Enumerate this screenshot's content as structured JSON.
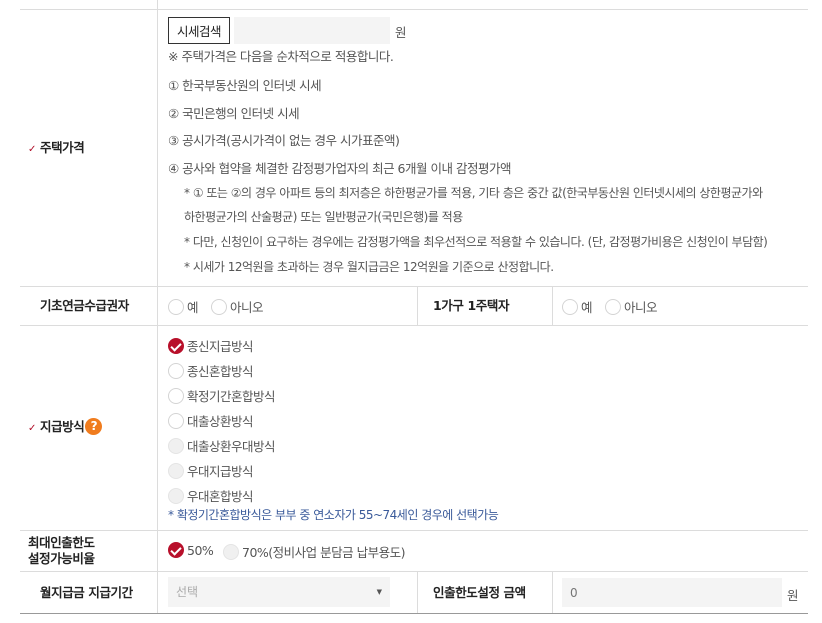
{
  "house_price": {
    "label": "주택가격",
    "search_button": "시세검색",
    "input_value": "",
    "unit": "원",
    "note": "※ 주택가격은 다음을 순차적으로 적용합니다.",
    "items": [
      "① 한국부동산원의 인터넷 시세",
      "② 국민은행의 인터넷 시세",
      "③ 공시가격(공시가격이 없는 경우 시가표준액)",
      "④ 공사와 협약을 체결한 감정평가업자의 최근 6개월 이내 감정평가액"
    ],
    "notes": [
      "* ① 또는 ②의 경우 아파트 등의 최저층은 하한평균가를 적용, 기타 층은 중간 값(한국부동산원 인터넷시세의 상한평균가와",
      "하한평균가의 산술평균) 또는 일반평균가(국민은행)를 적용",
      "* 다만, 신청인이 요구하는 경우에는 감정평가액을 최우선적으로 적용할 수 있습니다. (단, 감정평가비용은 신청인이 부담함)",
      "* 시세가 12억원을 초과하는 경우 월지급금은 12억원을 기준으로 산정합니다."
    ]
  },
  "basic_pension": {
    "label": "기초연금수급권자",
    "options": [
      "예",
      "아니오"
    ],
    "selected": null
  },
  "one_house": {
    "label": "1가구 1주택자",
    "options": [
      "예",
      "아니오"
    ],
    "selected": null
  },
  "payment_method": {
    "label": "지급방식",
    "help_icon": "?",
    "options": [
      "종신지급방식",
      "종신혼합방식",
      "확정기간혼합방식",
      "대출상환방식",
      "대출상환우대방식",
      "우대지급방식",
      "우대혼합방식"
    ],
    "selected": 0,
    "note": "* 확정기간혼합방식은 부부 중 연소자가 55~74세인 경우에 선택가능"
  },
  "max_withdrawal": {
    "label_line1": "최대인출한도",
    "label_line2": "설정가능비율",
    "options": [
      "50%",
      "70%(정비사업 분담금 납부용도)"
    ],
    "selected": 0
  },
  "monthly_period": {
    "label": "월지급금 지급기간",
    "placeholder": "선택"
  },
  "withdrawal_amount": {
    "label": "인출한도설정 금액",
    "placeholder": "0",
    "unit": "원"
  },
  "colors": {
    "accent_red": "#b8102b",
    "help_orange": "#f07c1e",
    "note_blue": "#3a5a9a"
  }
}
